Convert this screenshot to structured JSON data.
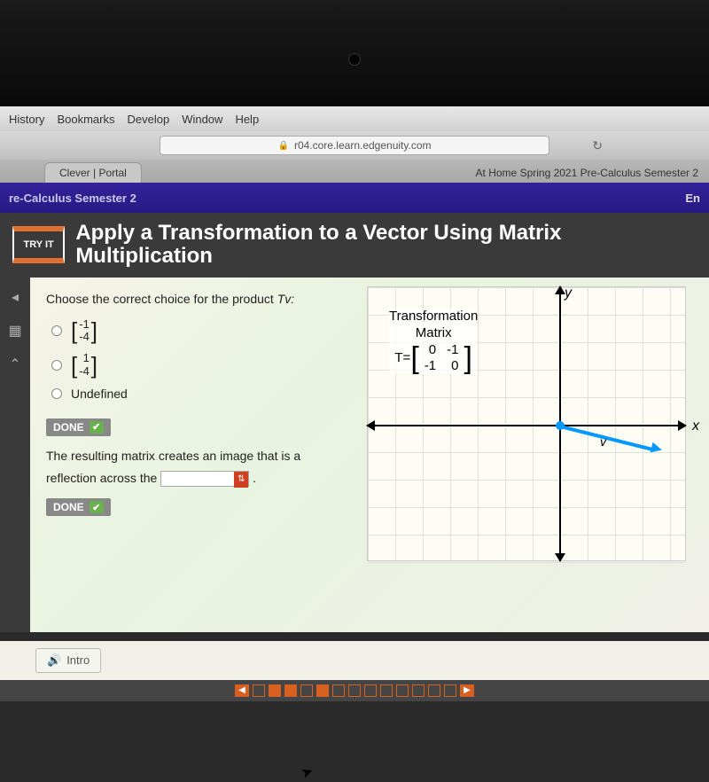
{
  "menubar": {
    "history": "History",
    "bookmarks": "Bookmarks",
    "develop": "Develop",
    "window": "Window",
    "help": "Help"
  },
  "browser": {
    "url": "r04.core.learn.edgenuity.com",
    "tab1": "Clever | Portal",
    "tab2": "At Home Spring 2021 Pre-Calculus Semester 2"
  },
  "course": {
    "name": "re-Calculus Semester 2",
    "lang": "En"
  },
  "lesson": {
    "tryit": "TRY IT",
    "title": "Apply a Transformation to a Vector Using Matrix Multiplication"
  },
  "question": {
    "prompt": "Choose the correct choice for the product ",
    "prompt_var": "Tv:",
    "options": {
      "a": {
        "r1": "-1",
        "r2": "-4"
      },
      "b": {
        "r1": "1",
        "r2": "-4"
      },
      "c": "Undefined"
    },
    "done": "DONE",
    "followup1": "The resulting matrix creates an image that is a",
    "followup2": "reflection across the",
    "period": "."
  },
  "graph": {
    "tm_title1": "Transformation",
    "tm_title2": "Matrix",
    "T_eq": "T=",
    "m": {
      "r1c1": "0",
      "r1c2": "-1",
      "r2c1": "-1",
      "r2c2": "0"
    },
    "xlabel": "x",
    "ylabel": "y",
    "vlabel": "v"
  },
  "footer": {
    "intro": "Intro"
  }
}
